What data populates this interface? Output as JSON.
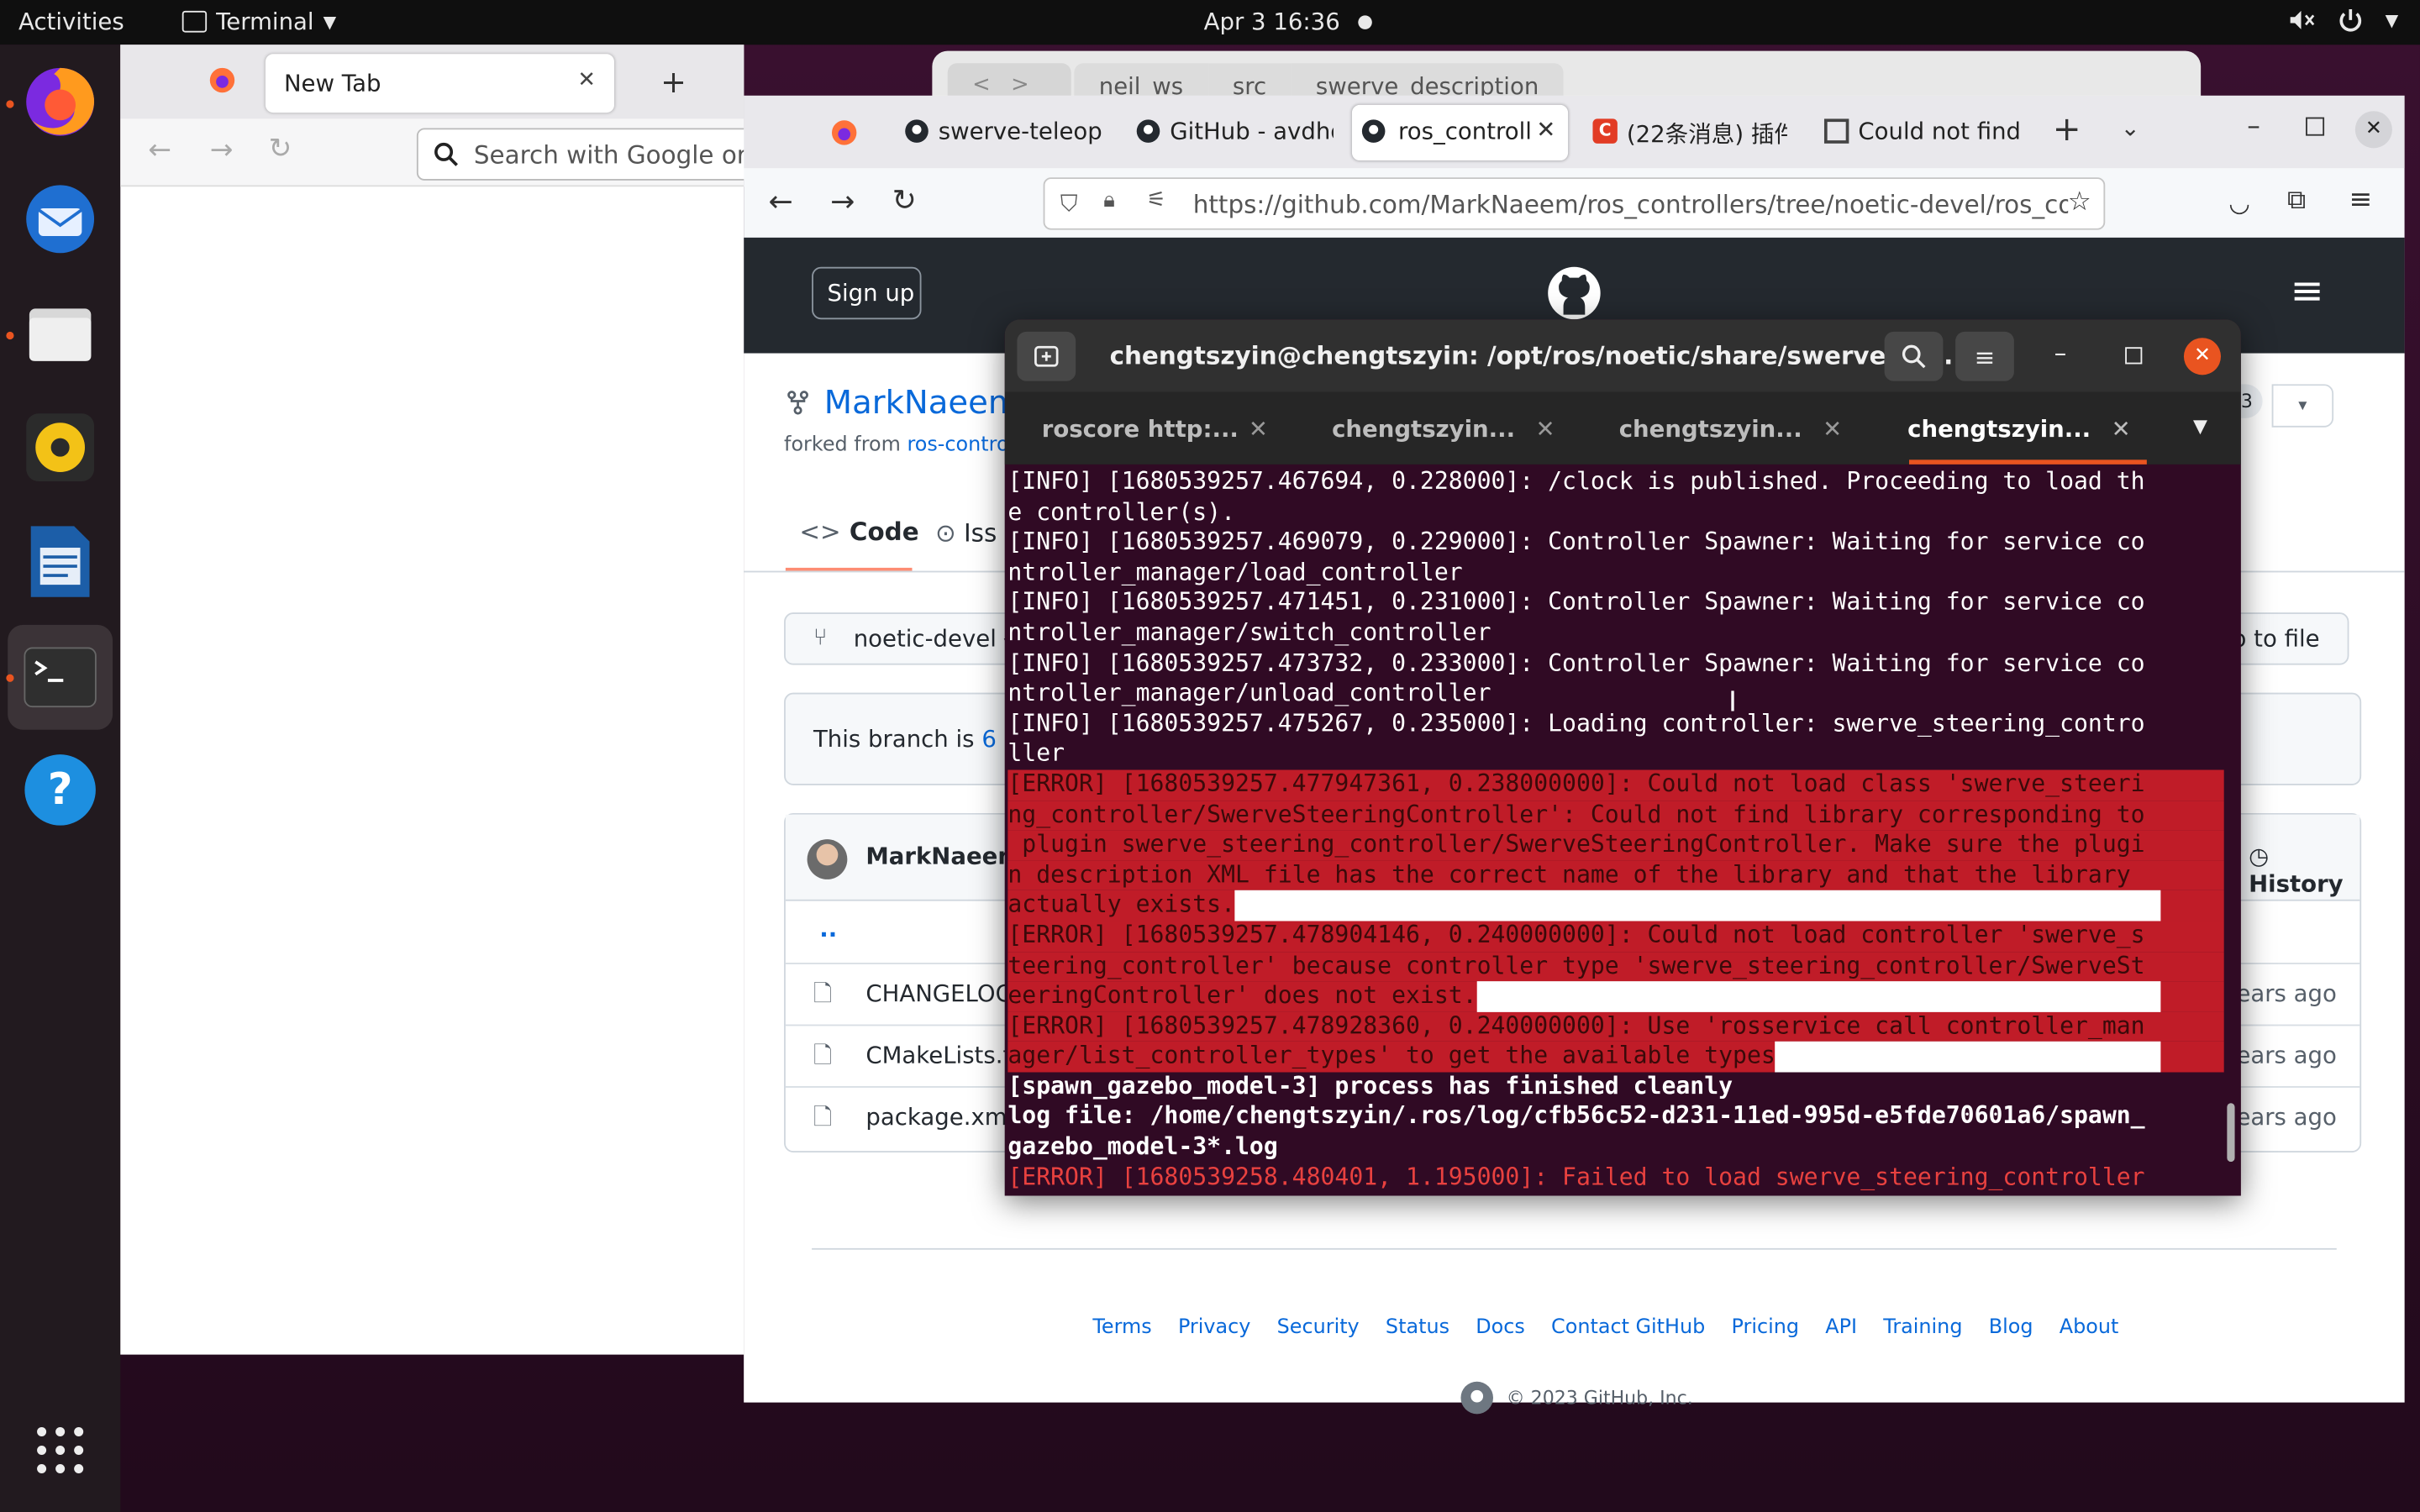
{
  "topbar": {
    "activities": "Activities",
    "app_name": "Terminal",
    "clock": "Apr 3  16:36"
  },
  "dock": {
    "items": [
      "firefox-icon",
      "thunderbird-icon",
      "files-icon",
      "rhythmbox-icon",
      "libreoffice-writer-icon",
      "terminal-icon",
      "help-icon",
      "show-apps-icon"
    ]
  },
  "firefox_back": {
    "tab_label": "New Tab",
    "search_placeholder": "Search with Google or e"
  },
  "files_window": {
    "breadcrumb": [
      "neil_ws",
      "src",
      "swerve_description"
    ]
  },
  "firefox": {
    "tabs": [
      {
        "label": "swerve-teleop"
      },
      {
        "label": "GitHub - avdho"
      },
      {
        "label": "ros_controll"
      },
      {
        "label": "(22条消息) 插件"
      },
      {
        "label": "Could not find"
      }
    ],
    "url": "https://github.com/MarkNaeem/ros_controllers/tree/noetic-devel/ros_co",
    "github": {
      "signup": "Sign up",
      "repo_owner": "MarkNaeem",
      "forked_label": "forked from ",
      "forked_link": "ros-controls/",
      "star_count": "13",
      "code_tab": "Code",
      "issues_tab": "Iss",
      "branch": "noetic-devel",
      "goto_file": "o to file",
      "branch_status_prefix": "This branch is ",
      "branch_status_link": "6 co",
      "commit_author": "MarkNaeem",
      "history": "History",
      "parent_dir": "..",
      "files": [
        {
          "name": "CHANGELOG",
          "age": "ears ago"
        },
        {
          "name": "CMakeLists.t",
          "age": "ears ago"
        },
        {
          "name": "package.xml",
          "age": "ears ago"
        }
      ],
      "footer_links": [
        "Terms",
        "Privacy",
        "Security",
        "Status",
        "Docs",
        "Contact GitHub",
        "Pricing",
        "API",
        "Training",
        "Blog",
        "About"
      ],
      "copyright": "© 2023 GitHub, Inc."
    }
  },
  "terminal": {
    "title": "chengtszyin@chengtszyin: /opt/ros/noetic/share/swerve_st...",
    "tabs": [
      {
        "label": "roscore http:..."
      },
      {
        "label": "chengtszyin..."
      },
      {
        "label": "chengtszyin..."
      },
      {
        "label": "chengtszyin..."
      }
    ],
    "lines": [
      {
        "text": "[INFO] [1680539257.467694, 0.228000]: /clock is published. Proceeding to load th",
        "kind": "info"
      },
      {
        "text": "e controller(s).",
        "kind": "info"
      },
      {
        "text": "[INFO] [1680539257.469079, 0.229000]: Controller Spawner: Waiting for service co",
        "kind": "info"
      },
      {
        "text": "ntroller_manager/load_controller",
        "kind": "info"
      },
      {
        "text": "[INFO] [1680539257.471451, 0.231000]: Controller Spawner: Waiting for service co",
        "kind": "info"
      },
      {
        "text": "ntroller_manager/switch_controller",
        "kind": "info"
      },
      {
        "text": "[INFO] [1680539257.473732, 0.233000]: Controller Spawner: Waiting for service co",
        "kind": "info"
      },
      {
        "text": "ntroller_manager/unload_controller",
        "kind": "info"
      },
      {
        "text": "[INFO] [1680539257.475267, 0.235000]: Loading controller: swerve_steering_contro",
        "kind": "info"
      },
      {
        "text": "ller",
        "kind": "info"
      },
      {
        "text": "[ERROR] [1680539257.477947361, 0.238000000]: Could not load class 'swerve_steeri",
        "kind": "err"
      },
      {
        "text": "ng_controller/SwerveSteeringController': Could not find library corresponding to",
        "kind": "err"
      },
      {
        "text": " plugin swerve_steering_controller/SwerveSteeringController. Make sure the plugi",
        "kind": "err"
      },
      {
        "text": "n description XML file has the correct name of the library and that the library",
        "kind": "err"
      },
      {
        "text": "actually exists.",
        "kind": "err",
        "fill": true
      },
      {
        "text": "[ERROR] [1680539257.478904146, 0.240000000]: Could not load controller 'swerve_s",
        "kind": "err"
      },
      {
        "text": "teering_controller' because controller type 'swerve_steering_controller/SwerveSt",
        "kind": "err"
      },
      {
        "text": "eeringController' does not exist.",
        "kind": "err",
        "fill": true
      },
      {
        "text": "[ERROR] [1680539257.478928360, 0.240000000]: Use 'rosservice call controller_man",
        "kind": "err"
      },
      {
        "text": "ager/list_controller_types' to get the available types",
        "kind": "err",
        "fill": true
      },
      {
        "text": "[spawn_gazebo_model-3] process has finished cleanly",
        "kind": "bold"
      },
      {
        "text": "log file: /home/chengtszyin/.ros/log/cfb56c52-d231-11ed-995d-e5fde70601a6/spawn_",
        "kind": "bold"
      },
      {
        "text": "gazebo_model-3*.log",
        "kind": "bold"
      },
      {
        "text": "[ERROR] [1680539258.480401, 1.195000]: Failed to load swerve_steering_controller",
        "kind": "errtxt"
      }
    ]
  }
}
